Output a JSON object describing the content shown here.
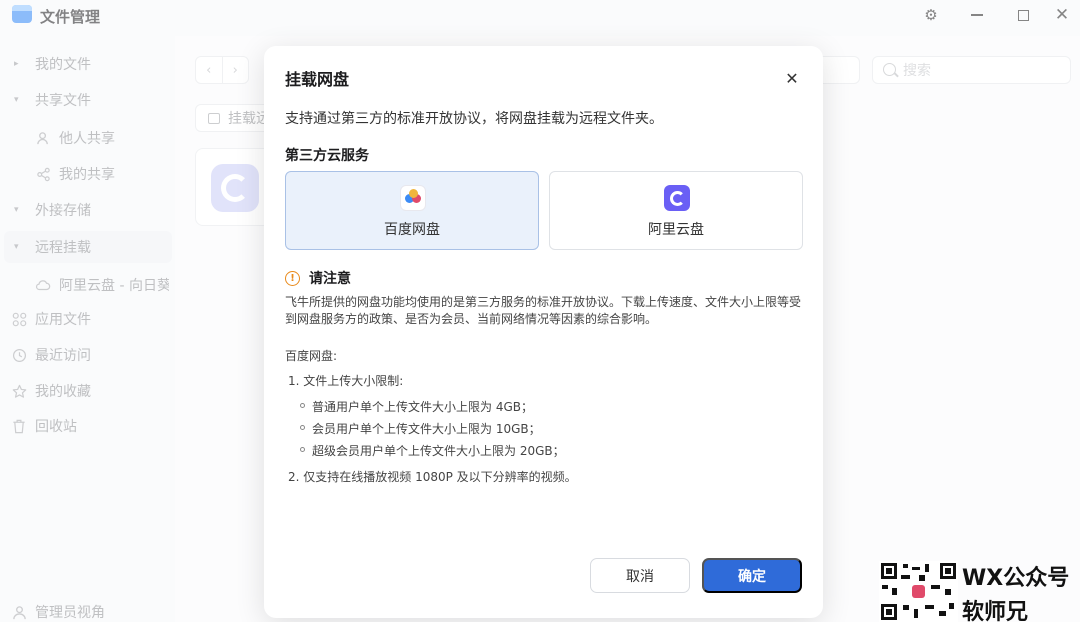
{
  "window": {
    "title": "文件管理",
    "controls": [
      "settings-icon",
      "minimize-icon",
      "maximize-icon",
      "close-icon"
    ]
  },
  "sidebar": {
    "items": [
      {
        "label": "我的文件",
        "caret": "▸"
      },
      {
        "label": "共享文件",
        "caret": "▾"
      },
      {
        "label": "他人共享",
        "icon": "users-icon"
      },
      {
        "label": "我的共享",
        "icon": "share-icon"
      },
      {
        "label": "外接存储",
        "caret": "▾"
      },
      {
        "label": "远程挂载",
        "caret": "▾",
        "active": true
      },
      {
        "label": "阿里云盘 - 向日葵",
        "icon": "cloud-icon"
      },
      {
        "label": "应用文件",
        "icon": "apps-icon"
      },
      {
        "label": "最近访问",
        "icon": "clock-icon"
      },
      {
        "label": "我的收藏",
        "icon": "star-icon"
      },
      {
        "label": "回收站",
        "icon": "trash-icon"
      },
      {
        "label": "管理员视角",
        "icon": "admin-icon"
      }
    ]
  },
  "toolbar": {
    "mount_label": "挂载远",
    "search_placeholder": "搜索"
  },
  "dialog": {
    "title": "挂载网盘",
    "description": "支持通过第三方的标准开放协议，将网盘挂载为远程文件夹。",
    "section_title": "第三方云服务",
    "options": [
      {
        "label": "百度网盘",
        "icon": "baidu-netdisk-icon",
        "selected": true
      },
      {
        "label": "阿里云盘",
        "icon": "aliyun-drive-icon",
        "selected": false
      }
    ],
    "notice_title": "请注意",
    "notice_text": "飞牛所提供的网盘功能均使用的是第三方服务的标准开放协议。下载上传速度、文件大小上限等受到网盘服务方的政策、是否为会员、当前网络情况等因素的综合影响。",
    "baidu_title": "百度网盘:",
    "list": {
      "item1": "1. 文件上传大小限制:",
      "sub_items": [
        "普通用户单个上传文件大小上限为 4GB；",
        "会员用户单个上传文件大小上限为 10GB；",
        "超级会员用户单个上传文件大小上限为 20GB；"
      ],
      "item2": "2. 仅支持在线播放视频 1080P 及以下分辨率的视频。"
    },
    "cancel_label": "取消",
    "ok_label": "确定"
  },
  "watermark": {
    "line1": "WX公众号",
    "line2": "软师兄"
  },
  "colors": {
    "accent": "#2f6bd9",
    "selected_bg": "#eaf1fb",
    "warning": "#e98a1b"
  }
}
